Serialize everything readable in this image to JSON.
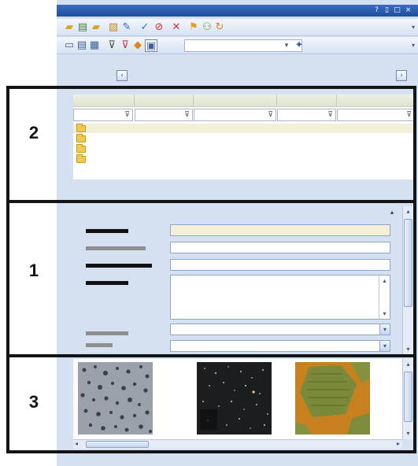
{
  "window": {
    "controls": [
      "?",
      "▯",
      "□",
      "×"
    ]
  },
  "toolbar1": {
    "icons": [
      "new-document-icon",
      "open-folder-icon",
      "folder-up-icon",
      "image-icon",
      "tools-icon",
      "check-icon",
      "cancel-icon",
      "delete-icon",
      "flag-icon",
      "group-icon",
      "sync-icon"
    ]
  },
  "toolbar2": {
    "icons": [
      "view-list-icon",
      "view-detail-icon",
      "view-thumbnails-icon",
      "filter-icon",
      "filter-clear-icon",
      "filter-apply-icon",
      "image-filter-icon",
      "options-icon"
    ],
    "filter_value": ""
  },
  "navigation": {
    "prev": "‹",
    "next": "›"
  },
  "regions": [
    {
      "label": "2"
    },
    {
      "label": "1"
    },
    {
      "label": "3"
    }
  ],
  "grid": {
    "columns": [
      "",
      "",
      "",
      "",
      ""
    ],
    "folder_rows": 4,
    "selected_row": 0
  },
  "form": {
    "fields": [
      {
        "label": "",
        "value": "",
        "type": "text",
        "highlighted": true
      },
      {
        "label": "",
        "value": "",
        "type": "text"
      },
      {
        "label": "",
        "value": "",
        "type": "text"
      },
      {
        "label": "",
        "value": "",
        "type": "multiline"
      },
      {
        "label": "",
        "value": "",
        "type": "dropdown"
      },
      {
        "label": "",
        "value": "",
        "type": "dropdown"
      }
    ]
  },
  "thumbnails": [
    {
      "name": "",
      "style": "grey-particles"
    },
    {
      "name": "",
      "style": "dark-particles"
    },
    {
      "name": "",
      "style": "green-grains"
    }
  ],
  "colors": {
    "panel": "#d5e0f1",
    "titlebar": "#1f4f9e",
    "outline": "#141414",
    "highlight_row": "#f3efd9"
  }
}
